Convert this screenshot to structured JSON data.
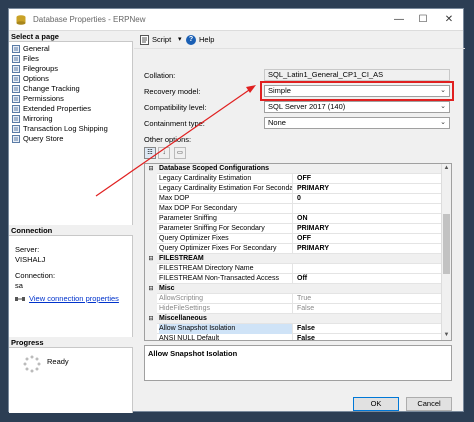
{
  "window": {
    "title": "Database Properties - ERPNew"
  },
  "left": {
    "select_page_header": "Select a page",
    "pages": [
      {
        "label": "General",
        "icon": "page-icon"
      },
      {
        "label": "Files",
        "icon": "page-icon"
      },
      {
        "label": "Filegroups",
        "icon": "page-icon"
      },
      {
        "label": "Options",
        "icon": "page-icon"
      },
      {
        "label": "Change Tracking",
        "icon": "page-icon"
      },
      {
        "label": "Permissions",
        "icon": "page-icon"
      },
      {
        "label": "Extended Properties",
        "icon": "page-icon"
      },
      {
        "label": "Mirroring",
        "icon": "page-icon"
      },
      {
        "label": "Transaction Log Shipping",
        "icon": "page-icon"
      },
      {
        "label": "Query Store",
        "icon": "page-icon"
      }
    ],
    "connection_header": "Connection",
    "server_label": "Server:",
    "server_value": "VISHALJ",
    "connection_label": "Connection:",
    "connection_value": "sa",
    "view_connection_link": "View connection properties",
    "progress_header": "Progress",
    "progress_status": "Ready"
  },
  "toolbar": {
    "script_label": "Script",
    "dropdown_glyph": "▾",
    "help_label": "Help"
  },
  "form": {
    "collation_label": "Collation:",
    "collation_value": "SQL_Latin1_General_CP1_CI_AS",
    "recovery_label": "Recovery model:",
    "recovery_value": "Simple",
    "compat_label": "Compatibility level:",
    "compat_value": "SQL Server 2017 (140)",
    "containment_label": "Containment type:",
    "containment_value": "None",
    "other_options_label": "Other options:"
  },
  "grid": {
    "rows": [
      {
        "type": "category",
        "name": "Database Scoped Configurations",
        "glyph": "⊟"
      },
      {
        "type": "prop",
        "name": "Legacy Cardinality Estimation",
        "value": "OFF"
      },
      {
        "type": "prop",
        "name": "Legacy Cardinality Estimation For Secondary",
        "value": "PRIMARY"
      },
      {
        "type": "prop",
        "name": "Max DOP",
        "value": "0"
      },
      {
        "type": "prop",
        "name": "Max DOP For Secondary",
        "value": ""
      },
      {
        "type": "prop",
        "name": "Parameter Sniffing",
        "value": "ON"
      },
      {
        "type": "prop",
        "name": "Parameter Sniffing For Secondary",
        "value": "PRIMARY"
      },
      {
        "type": "prop",
        "name": "Query Optimizer Fixes",
        "value": "OFF"
      },
      {
        "type": "prop",
        "name": "Query Optimizer Fixes For Secondary",
        "value": "PRIMARY"
      },
      {
        "type": "category",
        "name": "FILESTREAM",
        "glyph": "⊟"
      },
      {
        "type": "prop",
        "name": "FILESTREAM Directory Name",
        "value": ""
      },
      {
        "type": "prop",
        "name": "FILESTREAM Non-Transacted Access",
        "value": "Off"
      },
      {
        "type": "category",
        "name": "Misc",
        "glyph": "⊟"
      },
      {
        "type": "dim",
        "name": "AllowScripting",
        "value": "True"
      },
      {
        "type": "dim",
        "name": "HideFileSettings",
        "value": "False"
      },
      {
        "type": "category",
        "name": "Miscellaneous",
        "glyph": "⊟"
      },
      {
        "type": "selected",
        "name": "Allow Snapshot Isolation",
        "value": "False"
      },
      {
        "type": "prop",
        "name": "ANSI NULL Default",
        "value": "False"
      }
    ]
  },
  "description": {
    "text": "Allow Snapshot Isolation"
  },
  "buttons": {
    "ok": "OK",
    "cancel": "Cancel"
  },
  "colors": {
    "accent": "#0078d7",
    "annotation_red": "#e02020"
  }
}
